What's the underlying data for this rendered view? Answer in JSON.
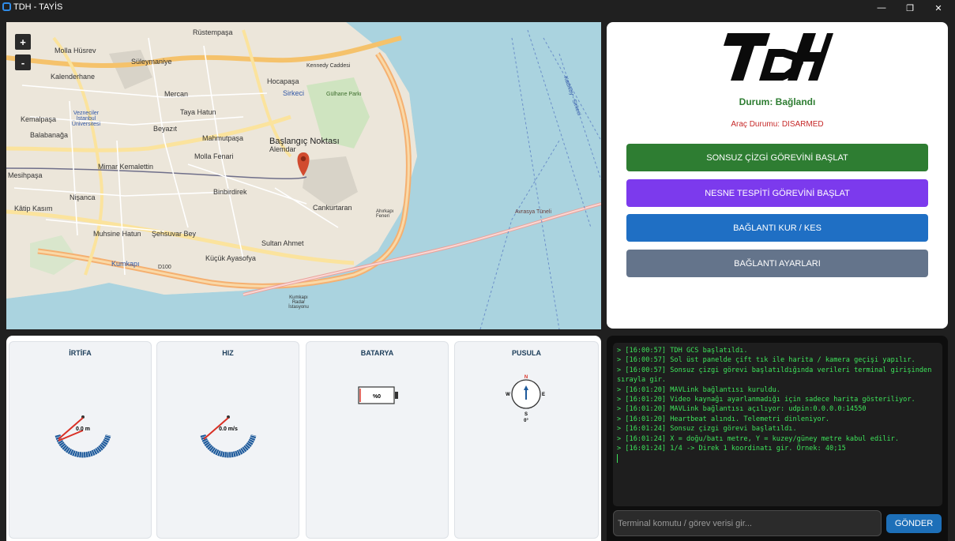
{
  "window": {
    "title": "TDH - TAYİS",
    "minimize": "—",
    "maximize": "❐",
    "close": "✕"
  },
  "map": {
    "zoom_in": "+",
    "zoom_out": "-",
    "marker_label": "Başlangıç Noktası",
    "labels": [
      "Rüstempaşa",
      "Molla Hüsrev",
      "Süleymaniye",
      "Kalenderhane",
      "Hocapaşa",
      "Sirkeci",
      "Kennedy Caddesi",
      "Mercan",
      "Taya Hatun",
      "Gülhane Parkı",
      "Kemalpaşa",
      "Balabanağa",
      "Vezneciler İstanbul Üniversitesi",
      "Beyazıt",
      "Alemdar",
      "Mahmutpaşa",
      "Molla Fenari",
      "Mesihpaşa",
      "Mimar Kemalettin",
      "Binbirdirek",
      "Nişanca",
      "Kâtip Kasım",
      "Şehsuvar Bey",
      "Sultan Ahmet",
      "Cankurtaran",
      "Muhsine Hatun",
      "Kumkapı",
      "Küçük Ayasofya",
      "Avrasya Tüneli",
      "D100",
      "Ahırkapı Feneri",
      "Kumkapı Radar İstasyonu",
      "Kadıköy - Sirkeci"
    ]
  },
  "control": {
    "logo": "TDH",
    "connection_status": "Durum: Bağlandı",
    "vehicle_status": "Araç Durumu: DISARMED",
    "buttons": {
      "infinite_line": "SONSUZ ÇİZGİ GÖREVİNİ BAŞLAT",
      "object_detection": "NESNE TESPİTİ GÖREVİNİ BAŞLAT",
      "connect": "BAĞLANTI KUR / KES",
      "settings": "BAĞLANTI AYARLARI"
    },
    "colors": {
      "status": "#2e7d32",
      "vehicle_status": "#c62828",
      "infinite_line": "#2e7d32",
      "object_detection": "#7c3aed",
      "connect": "#1f6fc4",
      "settings": "#64748b"
    }
  },
  "instruments": {
    "altitude": {
      "title": "İRTİFA",
      "value": 0.0,
      "unit": "m",
      "display": "0.0 m"
    },
    "speed": {
      "title": "HIZ",
      "value": 0.0,
      "unit": "m/s",
      "display": "0.0 m/s"
    },
    "battery": {
      "title": "BATARYA",
      "display": "%0",
      "percent": 0
    },
    "compass": {
      "title": "PUSULA",
      "north": "N",
      "south": "S",
      "east": "E",
      "west": "W",
      "heading": 0,
      "heading_display": "0°"
    }
  },
  "terminal": {
    "lines": [
      "> [16:00:57] TDH GCS başlatıldı.",
      "> [16:00:57] Sol üst panelde çift tık ile harita / kamera geçişi yapılır.",
      "> [16:00:57] Sonsuz çizgi görevi başlatıldığında verileri terminal girişinden sırayla gir.",
      "> [16:01:20] MAVLink bağlantısı kuruldu.",
      "> [16:01:20] Video kaynağı ayarlanmadığı için sadece harita gösteriliyor.",
      "> [16:01:20] MAVLink bağlantısı açılıyor: udpin:0.0.0.0:14550",
      "> [16:01:20] Heartbeat alındı. Telemetri dinleniyor.",
      "> [16:01:24] Sonsuz çizgi görevi başlatıldı.",
      "> [16:01:24] X = doğu/batı metre, Y = kuzey/güney metre kabul edilir.",
      "> [16:01:24] 1/4 -> Direk 1 koordinatı gir. Örnek: 40;15"
    ],
    "input_placeholder": "Terminal komutu / görev verisi gir...",
    "send_button": "GÖNDER"
  }
}
